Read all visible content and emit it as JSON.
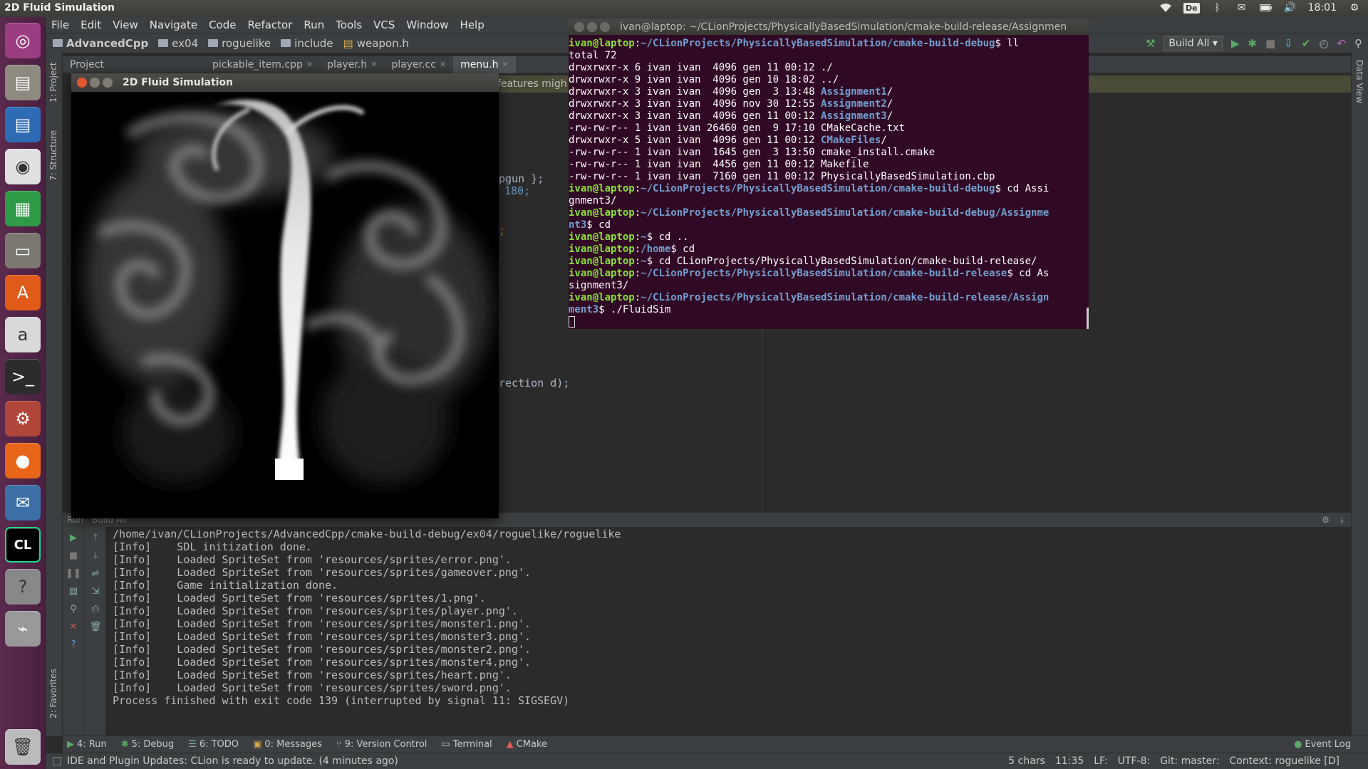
{
  "top_panel": {
    "window_title": "2D Fluid Simulation",
    "keyboard_layout": "De",
    "time": "18:01"
  },
  "launcher": [
    {
      "name": "ubuntu-dash",
      "color": "#9b3d83"
    },
    {
      "name": "files-app",
      "color": "#8e8a7f"
    },
    {
      "name": "writer-app",
      "color": "#2e6bb5"
    },
    {
      "name": "chrome-app",
      "color": "#e0e0e0"
    },
    {
      "name": "calc-app",
      "color": "#2e9b47"
    },
    {
      "name": "archive-app",
      "color": "#7a7770"
    },
    {
      "name": "software-center-app",
      "color": "#e05a1a"
    },
    {
      "name": "amazon-app",
      "color": "#d9d9d9"
    },
    {
      "name": "terminal-app",
      "color": "#2c2c2c"
    },
    {
      "name": "system-settings-app",
      "color": "#b0453a"
    },
    {
      "name": "firefox-app",
      "color": "#e8661a"
    },
    {
      "name": "thunderbird-app",
      "color": "#3b6fa6"
    },
    {
      "name": "clion-app",
      "color": "#12b4a5"
    },
    {
      "name": "help-app",
      "color": "#888"
    },
    {
      "name": "usb-app",
      "color": "#999"
    },
    {
      "name": "trash-app",
      "color": "#bbb"
    }
  ],
  "menubar": [
    "File",
    "Edit",
    "View",
    "Navigate",
    "Code",
    "Refactor",
    "Run",
    "Tools",
    "VCS",
    "Window",
    "Help"
  ],
  "navbar": {
    "crumbs": [
      "AdvancedCpp",
      "ex04",
      "roguelike",
      "include",
      "weapon.h"
    ],
    "build_config": "Build All"
  },
  "left_tabs": {
    "project": "1: Project",
    "structure": "7: Structure",
    "favorites": "2: Favorites"
  },
  "right_tabs": {
    "data_view": "Data View"
  },
  "editor_tabs": {
    "project_label": "Project",
    "tabs": [
      "pickable_item.cpp",
      "player.h",
      "player.cc",
      "menu.h"
    ]
  },
  "editor": {
    "warning": "features migh",
    "frag1": "pgun };",
    "frag2": "180;",
    "frag3": ";",
    "frag4": "rection d);"
  },
  "run_panel": {
    "header": "Run",
    "config": "Build All",
    "lines": [
      "/home/ivan/CLionProjects/AdvancedCpp/cmake-build-debug/ex04/roguelike/roguelike",
      "[Info]    SDL initization done.",
      "[Info]    Loaded SpriteSet from 'resources/sprites/error.png'.",
      "[Info]    Loaded SpriteSet from 'resources/sprites/gameover.png'.",
      "[Info]    Game initialization done.",
      "[Info]    Loaded SpriteSet from 'resources/sprites/1.png'.",
      "[Info]    Loaded SpriteSet from 'resources/sprites/player.png'.",
      "[Info]    Loaded SpriteSet from 'resources/sprites/monster1.png'.",
      "[Info]    Loaded SpriteSet from 'resources/sprites/monster3.png'.",
      "[Info]    Loaded SpriteSet from 'resources/sprites/monster2.png'.",
      "[Info]    Loaded SpriteSet from 'resources/sprites/monster4.png'.",
      "[Info]    Loaded SpriteSet from 'resources/sprites/heart.png'.",
      "[Info]    Loaded SpriteSet from 'resources/sprites/sword.png'.",
      "",
      "Process finished with exit code 139 (interrupted by signal 11: SIGSEGV)"
    ]
  },
  "bottom_tools": [
    "4: Run",
    "5: Debug",
    "6: TODO",
    "0: Messages",
    "9: Version Control",
    "Terminal",
    "CMake"
  ],
  "event_log": "Event Log",
  "status_bar": {
    "message": "IDE and Plugin Updates: CLion is ready to update. (4 minutes ago)",
    "chars": "5 chars",
    "position": "11:35",
    "line_sep": "LF:",
    "encoding": "UTF-8:",
    "git": "Git: master:",
    "context": "Context: roguelike [D]"
  },
  "fluid_window": {
    "title": "2D Fluid Simulation"
  },
  "terminal": {
    "title": "ivan@laptop: ~/CLionProjects/PhysicallyBasedSimulation/cmake-build-release/Assignmen",
    "lines": [
      [
        {
          "c": "t-user",
          "t": "ivan@laptop"
        },
        {
          "c": "",
          "t": ":"
        },
        {
          "c": "t-path",
          "t": "~/CLionProjects/PhysicallyBasedSimulation/cmake-build-debug"
        },
        {
          "c": "",
          "t": "$ ll"
        }
      ],
      [
        {
          "c": "",
          "t": "total 72"
        }
      ],
      [
        {
          "c": "",
          "t": "drwxrwxr-x 6 ivan ivan  4096 gen 11 00:12 ./"
        }
      ],
      [
        {
          "c": "",
          "t": "drwxrwxr-x 9 ivan ivan  4096 gen 10 18:02 ../"
        }
      ],
      [
        {
          "c": "",
          "t": "drwxrwxr-x 3 ivan ivan  4096 gen  3 13:48 "
        },
        {
          "c": "t-dir",
          "t": "Assignment1"
        },
        {
          "c": "",
          "t": "/"
        }
      ],
      [
        {
          "c": "",
          "t": "drwxrwxr-x 3 ivan ivan  4096 nov 30 12:55 "
        },
        {
          "c": "t-dir",
          "t": "Assignment2"
        },
        {
          "c": "",
          "t": "/"
        }
      ],
      [
        {
          "c": "",
          "t": "drwxrwxr-x 3 ivan ivan  4096 gen 11 00:12 "
        },
        {
          "c": "t-dir",
          "t": "Assignment3"
        },
        {
          "c": "",
          "t": "/"
        }
      ],
      [
        {
          "c": "",
          "t": "-rw-rw-r-- 1 ivan ivan 26460 gen  9 17:10 CMakeCache.txt"
        }
      ],
      [
        {
          "c": "",
          "t": "drwxrwxr-x 5 ivan ivan  4096 gen 11 00:12 "
        },
        {
          "c": "t-dir",
          "t": "CMakeFiles"
        },
        {
          "c": "",
          "t": "/"
        }
      ],
      [
        {
          "c": "",
          "t": "-rw-rw-r-- 1 ivan ivan  1645 gen  3 13:50 cmake_install.cmake"
        }
      ],
      [
        {
          "c": "",
          "t": "-rw-rw-r-- 1 ivan ivan  4456 gen 11 00:12 Makefile"
        }
      ],
      [
        {
          "c": "",
          "t": "-rw-rw-r-- 1 ivan ivan  7160 gen 11 00:12 PhysicallyBasedSimulation.cbp"
        }
      ],
      [
        {
          "c": "t-user",
          "t": "ivan@laptop"
        },
        {
          "c": "",
          "t": ":"
        },
        {
          "c": "t-path",
          "t": "~/CLionProjects/PhysicallyBasedSimulation/cmake-build-debug"
        },
        {
          "c": "",
          "t": "$ cd Assi"
        }
      ],
      [
        {
          "c": "",
          "t": "gnment3/"
        }
      ],
      [
        {
          "c": "t-user",
          "t": "ivan@laptop"
        },
        {
          "c": "",
          "t": ":"
        },
        {
          "c": "t-path",
          "t": "~/CLionProjects/PhysicallyBasedSimulation/cmake-build-debug/Assignme"
        }
      ],
      [
        {
          "c": "t-path",
          "t": "nt3"
        },
        {
          "c": "",
          "t": "$ cd"
        }
      ],
      [
        {
          "c": "t-user",
          "t": "ivan@laptop"
        },
        {
          "c": "",
          "t": ":"
        },
        {
          "c": "t-path",
          "t": "~"
        },
        {
          "c": "",
          "t": "$ cd .."
        }
      ],
      [
        {
          "c": "t-user",
          "t": "ivan@laptop"
        },
        {
          "c": "",
          "t": ":"
        },
        {
          "c": "t-path",
          "t": "/home"
        },
        {
          "c": "",
          "t": "$ cd"
        }
      ],
      [
        {
          "c": "t-user",
          "t": "ivan@laptop"
        },
        {
          "c": "",
          "t": ":"
        },
        {
          "c": "t-path",
          "t": "~"
        },
        {
          "c": "",
          "t": "$ cd CLionProjects/PhysicallyBasedSimulation/cmake-build-release/"
        }
      ],
      [
        {
          "c": "t-user",
          "t": "ivan@laptop"
        },
        {
          "c": "",
          "t": ":"
        },
        {
          "c": "t-path",
          "t": "~/CLionProjects/PhysicallyBasedSimulation/cmake-build-release"
        },
        {
          "c": "",
          "t": "$ cd As"
        }
      ],
      [
        {
          "c": "",
          "t": "signment3/"
        }
      ],
      [
        {
          "c": "t-user",
          "t": "ivan@laptop"
        },
        {
          "c": "",
          "t": ":"
        },
        {
          "c": "t-path",
          "t": "~/CLionProjects/PhysicallyBasedSimulation/cmake-build-release/Assign"
        }
      ],
      [
        {
          "c": "t-path",
          "t": "ment3"
        },
        {
          "c": "",
          "t": "$ ./FluidSim"
        }
      ]
    ]
  }
}
